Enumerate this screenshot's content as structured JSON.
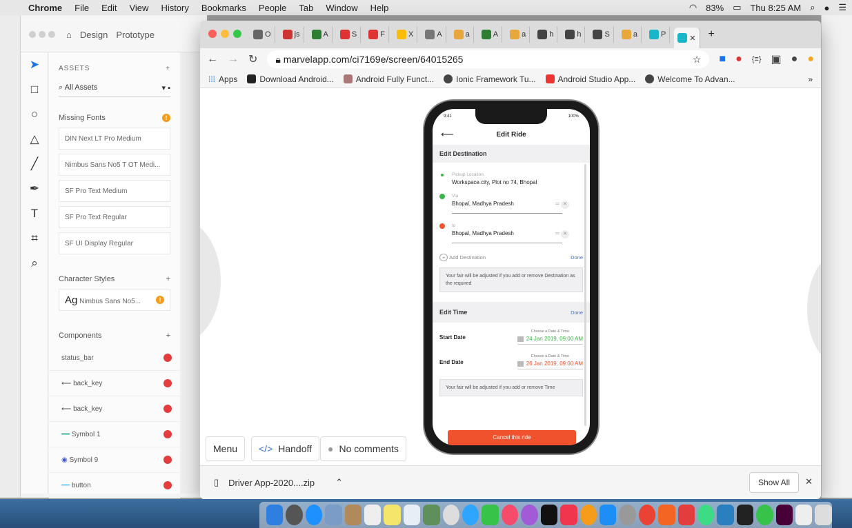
{
  "menubar": {
    "app": "Chrome",
    "items": [
      "File",
      "Edit",
      "View",
      "History",
      "Bookmarks",
      "People",
      "Tab",
      "Window",
      "Help"
    ],
    "battery": "83%",
    "clock": "Thu 8:25 AM"
  },
  "design": {
    "tabs": [
      "Design",
      "Prototype"
    ],
    "assets_label": "ASSETS",
    "search_label": "All Assets",
    "missing_fonts_label": "Missing Fonts",
    "fonts": [
      "DIN Next LT Pro Medium",
      "Nimbus Sans No5 T OT Medi...",
      "SF Pro Text Medium",
      "SF Pro Text Regular",
      "SF UI Display Regular"
    ],
    "character_styles_label": "Character Styles",
    "char_style_sample": "Ag",
    "char_style_name": "Nimbus Sans No5...",
    "components_label": "Components",
    "components": [
      "status_bar",
      "back_key",
      "back_key",
      "Symbol 1",
      "Symbol 9",
      "button"
    ]
  },
  "chrome": {
    "url": "marvelapp.com/ci7169e/screen/64015265",
    "bookmarks": [
      "Apps",
      "Download Android...",
      "Android Fully Funct...",
      "Ionic Framework Tu...",
      "Android Studio App...",
      "Welcome To Advan..."
    ],
    "tabs": [
      "O",
      "js",
      "A",
      "S",
      "F",
      "X",
      "A",
      "a",
      "A",
      "a",
      "h",
      "h",
      "S",
      "a",
      "P"
    ],
    "download_file": "Driver App-2020....zip",
    "show_all": "Show All"
  },
  "page_buttons": {
    "menu": "Menu",
    "handoff": "Handoff",
    "handoff_code": "</>",
    "comments": "No comments"
  },
  "phone": {
    "status_time": "9:41",
    "status_battery": "100%",
    "title": "Edit Ride",
    "edit_destination": "Edit Destination",
    "pickup_label": "Pickup Location",
    "pickup_value": "Workspace.city, Plot no 74, Bhopal",
    "via_label": "Via",
    "via_value": "Bhopal, Madhya Pradesh",
    "to_label": "to",
    "to_value": "Bhopal, Madhya Pradesh",
    "add_destination": "Add Destination",
    "done": "Done",
    "dest_note": "Your fair will be adjusted if you add or remove Destination as the required",
    "edit_time": "Edit Time",
    "choose_label": "Choose a Date & Time",
    "start_label": "Start Date",
    "start_value": "24 Jan 2019, 09:00 AM",
    "end_label": "End Date",
    "end_value": "26 Jan 2019, 09:00 AM",
    "time_note": "Your fair will be adjusted if you add or remove Time",
    "cancel": "Cancel this ride",
    "colors": {
      "green": "#3bb54a",
      "orange": "#f0522e",
      "link": "#3c72d6"
    }
  }
}
